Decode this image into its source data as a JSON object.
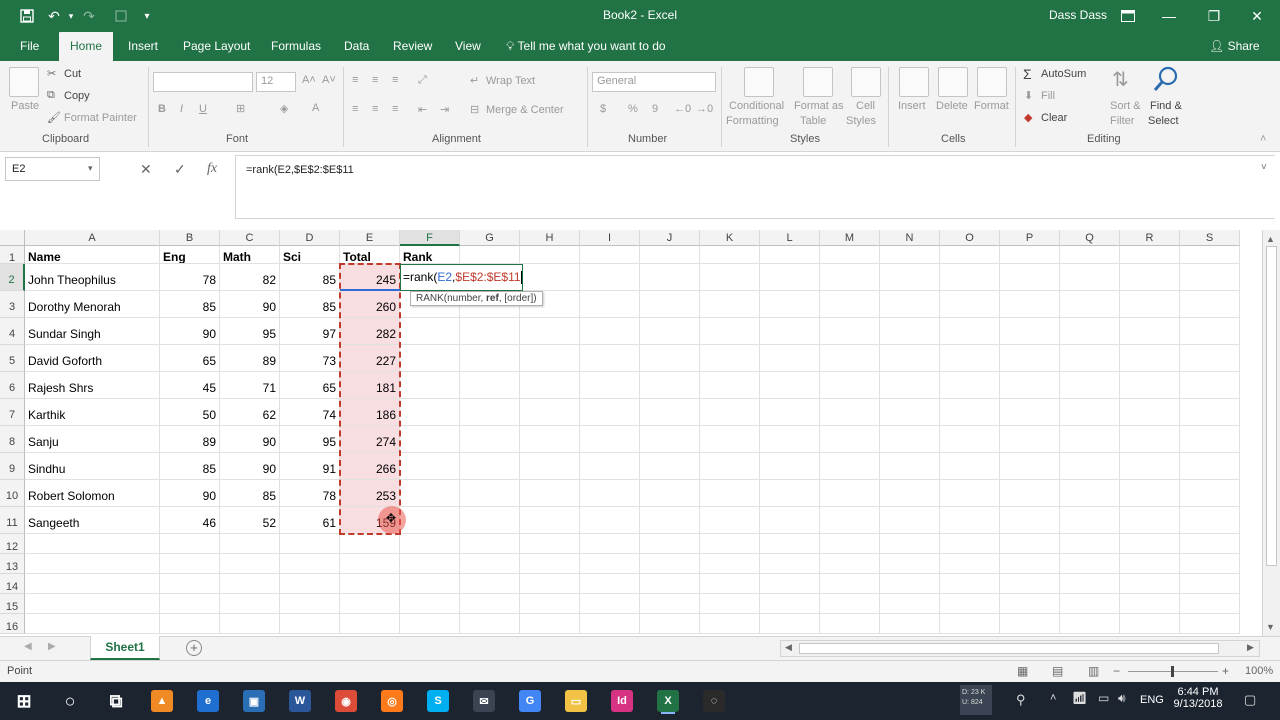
{
  "window": {
    "title": "Book2 - Excel",
    "user": "Dass Dass",
    "controls": {
      "minimize": "—",
      "restore": "❐",
      "close": "✕"
    }
  },
  "quick_access": {
    "save": "save-icon",
    "undo": "undo-icon",
    "redo": "redo-icon",
    "customize": "▾"
  },
  "ribbon_tabs": [
    "File",
    "Home",
    "Insert",
    "Page Layout",
    "Formulas",
    "Data",
    "Review",
    "View"
  ],
  "active_tab": "Home",
  "tell_me": "Tell me what you want to do",
  "share": "Share",
  "ribbon": {
    "clipboard": {
      "paste": "Paste",
      "cut": "Cut",
      "copy": "Copy",
      "format_painter": "Format Painter",
      "label": "Clipboard"
    },
    "font": {
      "name": "",
      "size": "12",
      "label": "Font",
      "bold": "B",
      "italic": "I",
      "underline": "U"
    },
    "alignment": {
      "wrap_text": "Wrap Text",
      "merge_center": "Merge & Center",
      "label": "Alignment"
    },
    "number": {
      "format": "General",
      "label": "Number",
      "currency": "$",
      "percent": "%",
      "comma": "9"
    },
    "styles": {
      "conditional": [
        "Conditional",
        "Formatting"
      ],
      "format_table": [
        "Format as",
        "Table"
      ],
      "cell_styles": [
        "Cell",
        "Styles"
      ],
      "label": "Styles"
    },
    "cells": {
      "insert": "Insert",
      "delete": "Delete",
      "format": "Format",
      "label": "Cells"
    },
    "editing": {
      "autosum": "AutoSum",
      "fill": "Fill",
      "clear": "Clear",
      "sort_filter": [
        "Sort &",
        "Filter"
      ],
      "find_select": [
        "Find &",
        "Select"
      ],
      "label": "Editing"
    }
  },
  "formula_bar": {
    "name_box": "E2",
    "cancel": "✕",
    "enter": "✓",
    "fx": "fx",
    "formula": "=rank(E2,$E$2:$E$11"
  },
  "columns": [
    "A",
    "B",
    "C",
    "D",
    "E",
    "F",
    "G",
    "H",
    "I",
    "J",
    "K",
    "L",
    "M",
    "N",
    "O",
    "P",
    "Q",
    "R",
    "S"
  ],
  "rows": [
    "1",
    "2",
    "3",
    "4",
    "5",
    "6",
    "7",
    "8",
    "9",
    "10",
    "11",
    "12",
    "13",
    "14",
    "15",
    "16"
  ],
  "headers": [
    "Name",
    "Eng",
    "Math",
    "Sci",
    "Total",
    "Rank"
  ],
  "data": [
    [
      "John Theophilus",
      "78",
      "82",
      "85",
      "245"
    ],
    [
      "Dorothy Menorah",
      "85",
      "90",
      "85",
      "260"
    ],
    [
      "Sundar Singh",
      "90",
      "95",
      "97",
      "282"
    ],
    [
      "David Goforth",
      "65",
      "89",
      "73",
      "227"
    ],
    [
      "Rajesh Shrs",
      "45",
      "71",
      "65",
      "181"
    ],
    [
      "Karthik",
      "50",
      "62",
      "74",
      "186"
    ],
    [
      "Sanju",
      "89",
      "90",
      "95",
      "274"
    ],
    [
      "Sindhu",
      "85",
      "90",
      "91",
      "266"
    ],
    [
      "Robert Solomon",
      "90",
      "85",
      "78",
      "253"
    ],
    [
      "Sangeeth",
      "46",
      "52",
      "61",
      "159"
    ]
  ],
  "edit_cell": {
    "prefix": "=rank(",
    "arg1": "E2",
    "comma": ",",
    "arg2": "$E$2:$E$11"
  },
  "tooltip": {
    "pre": "RANK(number, ",
    "bold": "ref",
    "post": ", [order])"
  },
  "sheet_tab": "Sheet1",
  "add_sheet": "+",
  "status": {
    "mode": "Point",
    "zoom": "100%"
  },
  "taskbar": {
    "time": "6:44 PM",
    "date": "9/13/2018",
    "lang": "ENG",
    "net": [
      "D: 23 K",
      "U: 824"
    ],
    "apps": [
      "start",
      "cortana",
      "task-view",
      "vlc",
      "edge",
      "store",
      "word",
      "chrome",
      "firefox",
      "skype",
      "mail",
      "google",
      "explorer",
      "indesign",
      "excel",
      "obs"
    ]
  },
  "colors": {
    "accent": "#217346",
    "ref_red": "#c0392b",
    "range_fill": "#f8dde1"
  }
}
